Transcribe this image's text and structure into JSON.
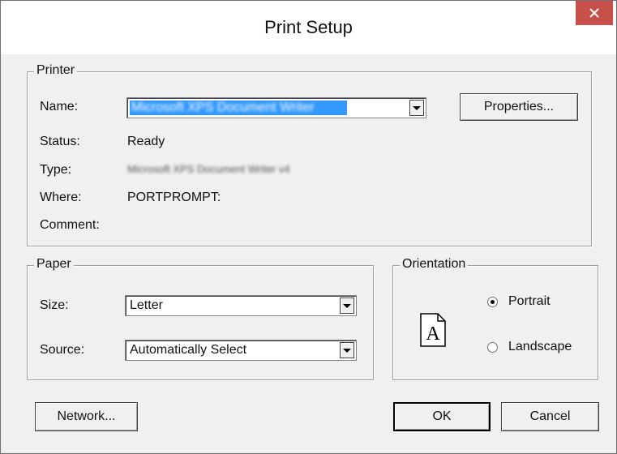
{
  "window": {
    "title": "Print Setup"
  },
  "printer_group": {
    "legend": "Printer",
    "name_label": "Name:",
    "name_value": "Microsoft XPS Document Writer",
    "properties_button": "Properties...",
    "status_label": "Status:",
    "status_value": "Ready",
    "type_label": "Type:",
    "type_value": "Microsoft XPS Document Writer v4",
    "where_label": "Where:",
    "where_value": "PORTPROMPT:",
    "comment_label": "Comment:"
  },
  "paper_group": {
    "legend": "Paper",
    "size_label": "Size:",
    "size_value": "Letter",
    "source_label": "Source:",
    "source_value": "Automatically Select"
  },
  "orientation_group": {
    "legend": "Orientation",
    "icon_letter": "A",
    "portrait_label": "Portrait",
    "landscape_label": "Landscape",
    "selected": "Portrait"
  },
  "buttons": {
    "network": "Network...",
    "ok": "OK",
    "cancel": "Cancel"
  },
  "colors": {
    "close_button": "#c7504b",
    "selection_highlight": "#3399ff",
    "dialog_background": "#f0f0f0"
  }
}
